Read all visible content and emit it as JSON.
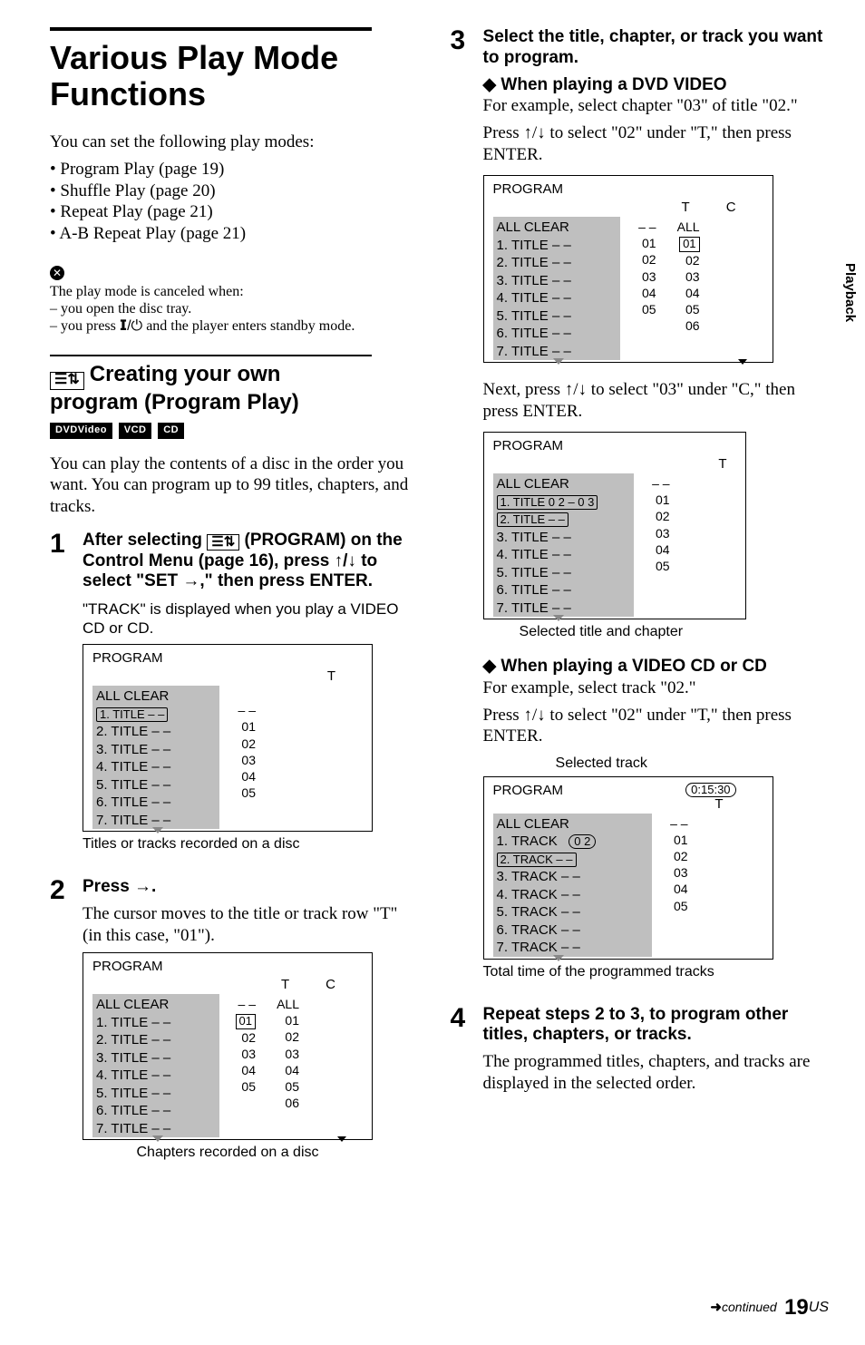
{
  "sideTab": "Playback",
  "left": {
    "title": "Various Play Mode Functions",
    "intro": "You can set the following play modes:",
    "modes": [
      "Program Play (page 19)",
      "Shuffle Play (page 20)",
      "Repeat Play (page 21)",
      "A-B Repeat Play (page 21)"
    ],
    "noteIconGlyph": "✕",
    "notesIntro": "The play mode is canceled when:",
    "notes": [
      "you open the disc tray.",
      "you press "
    ],
    "notesTail": " and the player enters standby mode.",
    "powerGlyph": "⏻",
    "h2a": "Creating your own",
    "h2b": "program (Program Play)",
    "modeIconGlyph": "☰⇅",
    "badges": [
      "DVDVideo",
      "VCD",
      "CD"
    ],
    "progIntro": "You can play the contents of a disc in the order you want. You can program up to 99 titles, chapters, and tracks.",
    "step1": {
      "num": "1",
      "headA": "After selecting ",
      "headB": " (PROGRAM) on the Control Menu (page 16), press ↑/↓ to select \"SET →,\" then press ENTER.",
      "note": "\"TRACK\" is displayed when you play a VIDEO CD or CD."
    },
    "screen1": {
      "hdr": "PROGRAM",
      "t": "T",
      "grey": [
        "ALL CLEAR",
        "1. TITLE   – –",
        "2. TITLE   – –",
        "3. TITLE   – –",
        "4. TITLE   – –",
        "5. TITLE   – –",
        "6. TITLE   – –",
        "7. TITLE   – –"
      ],
      "nums": [
        "– –",
        "01",
        "02",
        "03",
        "04",
        "05"
      ]
    },
    "caption1": "Titles or tracks recorded on a disc",
    "step2": {
      "num": "2",
      "head": "Press →.",
      "body": "The cursor moves to the title or track row \"T\" (in this case, \"01\")."
    },
    "screen2": {
      "hdr": "PROGRAM",
      "t": "T",
      "c": "C",
      "grey": [
        "ALL CLEAR",
        "1. TITLE   – –",
        "2. TITLE   – –",
        "3. TITLE   – –",
        "4. TITLE   – –",
        "5. TITLE   – –",
        "6. TITLE   – –",
        "7. TITLE   – –"
      ],
      "colT": [
        "– –",
        "01",
        "02",
        "03",
        "04",
        "05"
      ],
      "colC": [
        "ALL",
        "01",
        "02",
        "03",
        "04",
        "05",
        "06"
      ],
      "boxT1": "01"
    },
    "caption2": "Chapters recorded on a disc"
  },
  "right": {
    "step3": {
      "num": "3",
      "head": "Select the title, chapter, or track you want to program.",
      "d1": "When playing a DVD VIDEO",
      "p1a": "For example, select chapter \"03\" of title \"02.\"",
      "p1b": "Press ↑/↓ to select \"02\" under \"T,\" then press ENTER."
    },
    "screen3": {
      "hdr": "PROGRAM",
      "t": "T",
      "c": "C",
      "grey": [
        "ALL CLEAR",
        "1. TITLE   – –",
        "2. TITLE   – –",
        "3. TITLE   – –",
        "4. TITLE   – –",
        "5. TITLE   – –",
        "6. TITLE   – –",
        "7. TITLE   – –"
      ],
      "colT": [
        "– –",
        "01",
        "02",
        "03",
        "04",
        "05"
      ],
      "colC": [
        "ALL",
        "01",
        "02",
        "03",
        "04",
        "05",
        "06"
      ],
      "boxC": "01"
    },
    "midText": "Next, press ↑/↓ to select \"03\" under \"C,\" then press ENTER.",
    "screen4": {
      "hdr": "PROGRAM",
      "t": "T",
      "grey": [
        "ALL CLEAR",
        "1. TITLE  0 2 – 0 3",
        "2. TITLE   – –",
        "3. TITLE   – –",
        "4. TITLE   – –",
        "5. TITLE   – –",
        "6. TITLE   – –",
        "7. TITLE   – –"
      ],
      "colT": [
        "– –",
        "01",
        "02",
        "03",
        "04",
        "05"
      ]
    },
    "caption4": "Selected title and chapter",
    "d2": "When playing a VIDEO CD or CD",
    "p2a": "For example, select track \"02.\"",
    "p2b": "Press ↑/↓ to select \"02\" under \"T,\" then press ENTER.",
    "caption5top": "Selected track",
    "screen5": {
      "hdr": "PROGRAM",
      "t": "T",
      "time": "0:15:30",
      "grey": [
        "ALL CLEAR",
        "1. TRACK",
        "2. TRACK     – –",
        "3. TRACK     – –",
        "4. TRACK     – –",
        "5. TRACK     – –",
        "6. TRACK     – –",
        "7. TRACK     – –"
      ],
      "ovalTrack": "0 2",
      "colT": [
        "– –",
        "01",
        "02",
        "03",
        "04",
        "05"
      ]
    },
    "caption5": "Total time of the programmed tracks",
    "step4": {
      "num": "4",
      "head": "Repeat steps 2 to 3, to program other titles, chapters, or tracks.",
      "body": "The programmed titles, chapters, and tracks are displayed in the selected order."
    }
  },
  "footer": {
    "cont": "continued",
    "page": "19",
    "region": "US"
  }
}
